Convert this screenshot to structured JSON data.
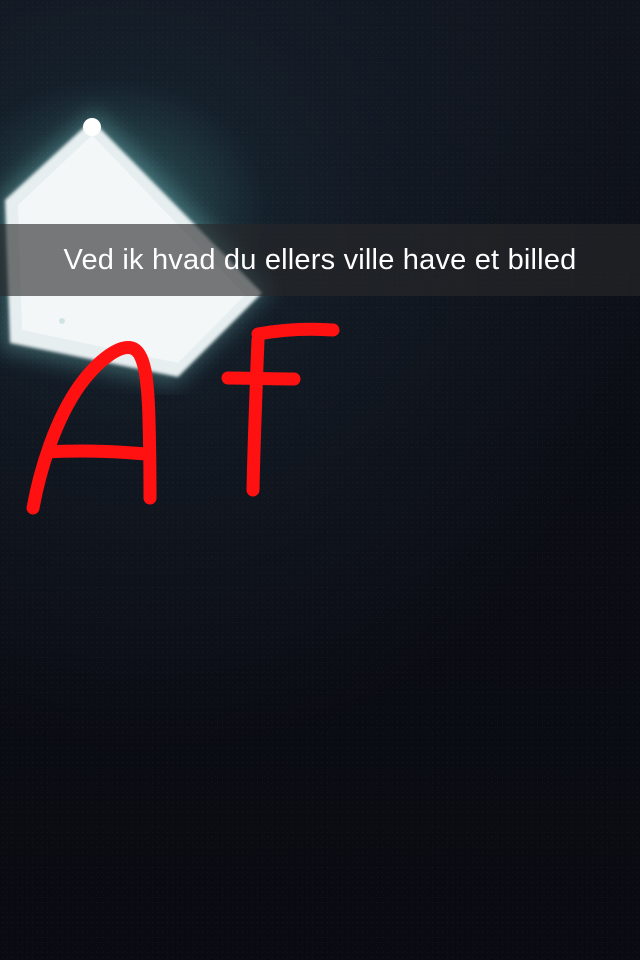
{
  "caption": {
    "text": "Ved ik hvad du ellers ville have et billed"
  },
  "drawing": {
    "color": "#ff1111",
    "text": "Af"
  },
  "photo": {
    "background_color": "#0b0d14",
    "glow_color": "#dfe9ec"
  }
}
